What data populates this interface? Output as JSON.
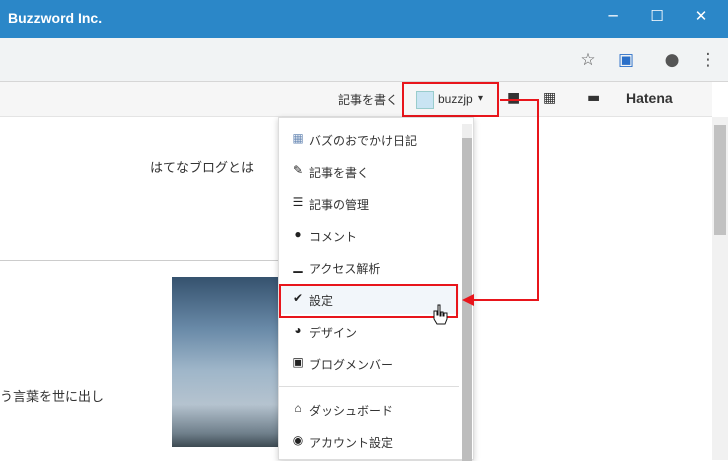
{
  "window": {
    "title": "Buzzword Inc.",
    "minimize": "─",
    "maximize": "☐",
    "close": "✕"
  },
  "toolbar": {
    "star_icon": "☆",
    "ext_icon": "▣",
    "profile_icon": "●",
    "menu_icon": "⋮"
  },
  "hatena_bar": {
    "write_article": "記事を書く",
    "username": "buzzjp",
    "caret": "▾",
    "bookmark_icon": "■",
    "apps_icon": "▦",
    "comment_icon": "▬",
    "logo": "Hatena"
  },
  "content": {
    "about": "はてなブログとは",
    "partial_text": "う言葉を世に出し"
  },
  "dropdown": {
    "items": [
      {
        "icon": "▦",
        "label": "バズのおでかけ日記"
      },
      {
        "icon": "✎",
        "label": "記事を書く"
      },
      {
        "icon": "☰",
        "label": "記事の管理"
      },
      {
        "icon": "●",
        "label": "コメント"
      },
      {
        "icon": "▁",
        "label": "アクセス解析"
      },
      {
        "icon": "✔",
        "label": "設定"
      },
      {
        "icon": "◕",
        "label": "デザイン"
      },
      {
        "icon": "▣",
        "label": "ブログメンバー"
      },
      {
        "icon": "⌂",
        "label": "ダッシュボード"
      },
      {
        "icon": "◉",
        "label": "アカウント設定"
      }
    ]
  },
  "colors": {
    "titlebar": "#2b87c8",
    "highlight": "#e8151b"
  }
}
